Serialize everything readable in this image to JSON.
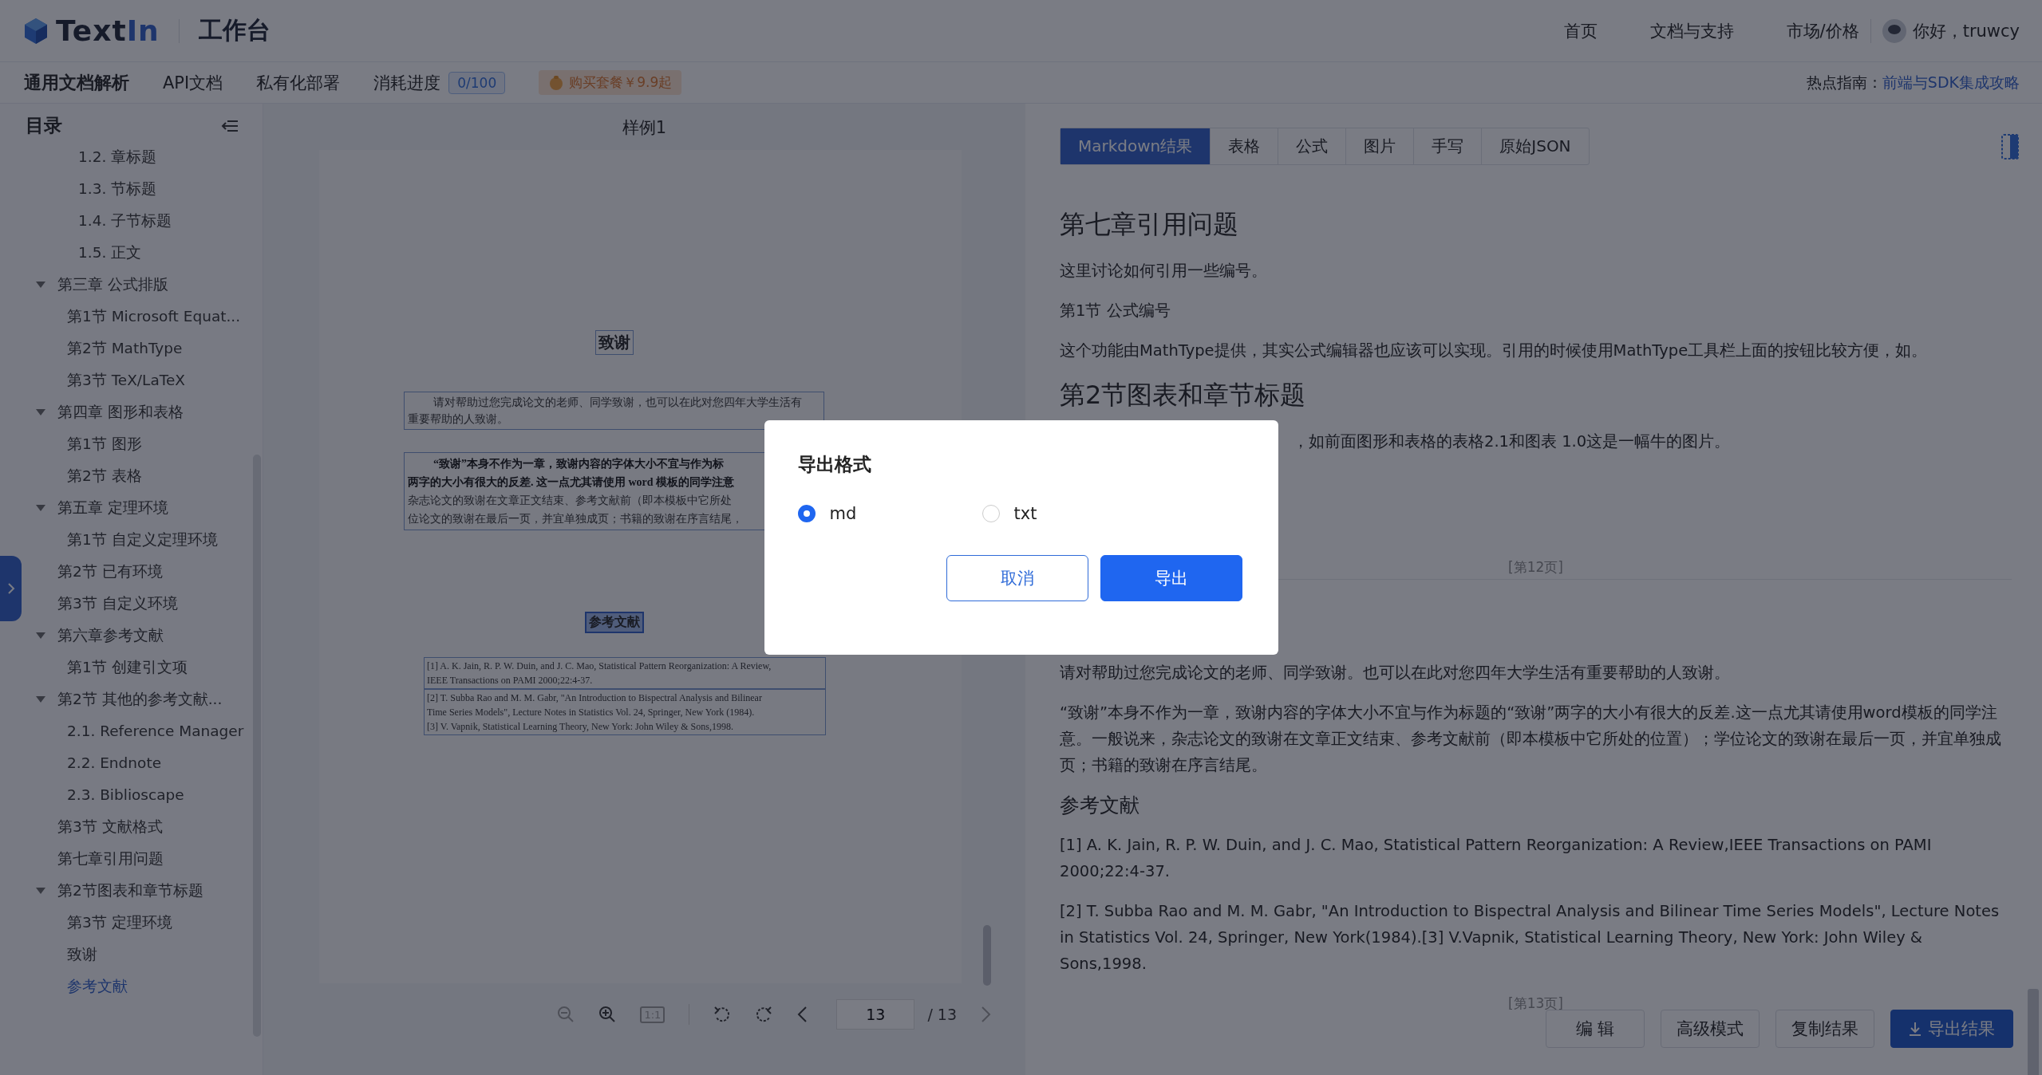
{
  "header": {
    "logo_dark": "Text",
    "logo_accent": "In",
    "product": "工作台",
    "nav": [
      {
        "label": "首页"
      },
      {
        "label": "文档与支持"
      },
      {
        "label": "市场/价格"
      }
    ],
    "user": {
      "greeting": "你好，truwcy"
    }
  },
  "subnav": {
    "items": [
      {
        "label": "通用文档解析",
        "selected": true
      },
      {
        "label": "API文档",
        "selected": false
      },
      {
        "label": "私有化部署",
        "selected": false
      }
    ],
    "usage": {
      "label": "消耗进度",
      "value": "0/100"
    },
    "promo": "购买套餐￥9.9起",
    "hot_label": "热点指南：",
    "hot_link": "前端与SDK集成攻略"
  },
  "toc": {
    "title": "目录",
    "continued_items": [
      {
        "label": "1.2. 章标题",
        "selected": false
      },
      {
        "label": "1.3. 节标题",
        "selected": false
      },
      {
        "label": "1.4. 子节标题",
        "selected": false
      },
      {
        "label": "1.5. 正文",
        "selected": false
      }
    ],
    "items": [
      {
        "label": "第三章 公式排版",
        "selected": false,
        "expanded": true,
        "children": [
          {
            "label": "第1节 Microsoft Equat...",
            "selected": false
          },
          {
            "label": "第2节 MathType",
            "selected": false
          },
          {
            "label": "第3节 TeX/LaTeX",
            "selected": false
          }
        ]
      },
      {
        "label": "第四章 图形和表格",
        "selected": false,
        "expanded": true,
        "children": [
          {
            "label": "第1节 图形",
            "selected": false
          },
          {
            "label": "第2节 表格",
            "selected": false
          }
        ]
      },
      {
        "label": "第五章 定理环境",
        "selected": false,
        "expanded": true,
        "children": [
          {
            "label": "第1节 自定义定理环境",
            "selected": false
          }
        ]
      },
      {
        "label": "第2节 已有环境",
        "selected": false
      },
      {
        "label": "第3节 自定义环境",
        "selected": false
      },
      {
        "label": "第六章参考文献",
        "selected": false,
        "expanded": true,
        "children": [
          {
            "label": "第1节 创建引文项",
            "selected": false
          }
        ]
      },
      {
        "label": "第2节 其他的参考文献...",
        "selected": false,
        "expanded": true,
        "children": [
          {
            "label": "2.1. Reference Manager",
            "selected": false
          },
          {
            "label": "2.2. Endnote",
            "selected": false
          },
          {
            "label": "2.3. Biblioscape",
            "selected": false
          }
        ]
      },
      {
        "label": "第3节 文献格式",
        "selected": false
      },
      {
        "label": "第七章引用问题",
        "selected": false
      },
      {
        "label": "第2节图表和章节标题",
        "selected": false,
        "expanded": true,
        "children": [
          {
            "label": "第3节 定理环境",
            "selected": false
          },
          {
            "label": "致谢",
            "selected": false
          },
          {
            "label": "参考文献",
            "selected": true
          }
        ]
      }
    ]
  },
  "viewer": {
    "title": "样例1",
    "page": {
      "heading": "致谢",
      "paragraph_1": [
        "请对帮助过您完成论文的老师、同学致谢，也可以在此对您四年大学生活有",
        "重要帮助的人致谢。"
      ],
      "paragraph_2": [
        {
          "text": "“致谢”本身不作为一章，致谢内容的字体大小不宜与作为标",
          "bold": true
        },
        {
          "text": "两字的大小有很大的反差. 这一点尤其请使用 word 模板的同学注意",
          "bold": true
        },
        {
          "text": "杂志论文的致谢在文章正文结束、参考文献前（即本模板中它所处",
          "bold": false
        },
        {
          "text": "位论文的致谢在最后一页，并宜单独成页；书籍的致谢在序言结尾，",
          "bold": false
        }
      ],
      "section_heading": "参考文献",
      "reference_blocks": [
        [
          "[1]  A. K. Jain, R. P. W. Duin, and J. C. Mao, Statistical Pattern Reorganization: A Review,",
          "IEEE Transactions on PAMI 2000;22:4-37."
        ],
        [
          "[2]  T. Subba Rao and M. M. Gabr, \"An Introduction to Bispectral Analysis and Bilinear",
          "Time Series Models\", Lecture Notes in Statistics Vol. 24, Springer, New York (1984).",
          "[3]  V. Vapnik, Statistical Learning Theory, New York: John Wiley & Sons,1998."
        ]
      ]
    },
    "toolbar": {
      "tools": [
        {
          "kind": "zoom_out",
          "disabled": true
        },
        {
          "kind": "zoom_in",
          "disabled": false
        },
        {
          "kind": "actual_size",
          "label": "1:1",
          "disabled": true
        },
        {
          "kind": "rotate_left",
          "disabled": false
        },
        {
          "kind": "rotate_right",
          "disabled": false
        }
      ],
      "prev_disabled": false,
      "page_input": "13",
      "page_total": "/ 13",
      "next_disabled": true
    }
  },
  "result": {
    "tabs": [
      {
        "label": "Markdown结果",
        "selected": true
      },
      {
        "label": "表格",
        "selected": false
      },
      {
        "label": "公式",
        "selected": false
      },
      {
        "label": "图片",
        "selected": false
      },
      {
        "label": "手写",
        "selected": false
      },
      {
        "label": "原始JSON",
        "selected": false
      }
    ],
    "blocks": [
      {
        "kind": "h1",
        "text": "第七章引用问题"
      },
      {
        "kind": "p",
        "text": "这里讨论如何引用一些编号。"
      },
      {
        "kind": "p",
        "text": "第1节 公式编号"
      },
      {
        "kind": "p",
        "text": "这个功能由MathType提供，其实公式编辑器也应该可以实现。引用的时候使用MathType工具栏上面的按钮比较方便，如。"
      },
      {
        "kind": "h1",
        "text": "第2节图表和章节标题"
      },
      {
        "kind": "covered",
        "text": "，如前面图形和表格的表格2.1和图表 1.0这是一幅牛的图片。"
      },
      {
        "kind": "page_mark",
        "text": "[第12页]"
      },
      {
        "kind": "p",
        "text": "请对帮助过您完成论文的老师、同学致谢。也可以在此对您四年大学生活有重要帮助的人致谢。"
      },
      {
        "kind": "p",
        "text": "“致谢”本身不作为一章，致谢内容的字体大小不宜与作为标题的“致谢”两字的大小有很大的反差.这一点尤其请使用word模板的同学注意。一般说来，杂志论文的致谢在文章正文结束、参考文献前（即本模板中它所处的位置）；学位论文的致谢在最后一页，并宜单独成页；书籍的致谢在序言结尾。"
      },
      {
        "kind": "h3",
        "text": "参考文献"
      },
      {
        "kind": "p",
        "text": "[1] A. K. Jain, R. P. W. Duin, and J. C. Mao, Statistical Pattern Reorganization: A Review,IEEE Transactions on PAMI 2000;22:4-37."
      },
      {
        "kind": "p",
        "text": "[2] T. Subba Rao and M. M. Gabr, \"An Introduction to Bispectral Analysis and Bilinear Time Series Models\", Lecture Notes in Statistics Vol. 24, Springer, New York(1984).[3] V.Vapnik, Statistical Learning Theory, New York: John Wiley & Sons,1998."
      },
      {
        "kind": "page_mark",
        "text": "[第13页]"
      }
    ],
    "actions": [
      {
        "label": "编 辑",
        "kind": "default"
      },
      {
        "label": "高级模式",
        "kind": "default"
      },
      {
        "label": "复制结果",
        "kind": "default"
      },
      {
        "label": "导出结果",
        "kind": "primary"
      }
    ]
  },
  "dialog": {
    "title": "导出格式",
    "options": [
      {
        "label": "md",
        "selected": true
      },
      {
        "label": "txt",
        "selected": false
      }
    ],
    "buttons": [
      {
        "label": "取消",
        "kind": "default"
      },
      {
        "label": "导出",
        "kind": "primary"
      }
    ]
  }
}
